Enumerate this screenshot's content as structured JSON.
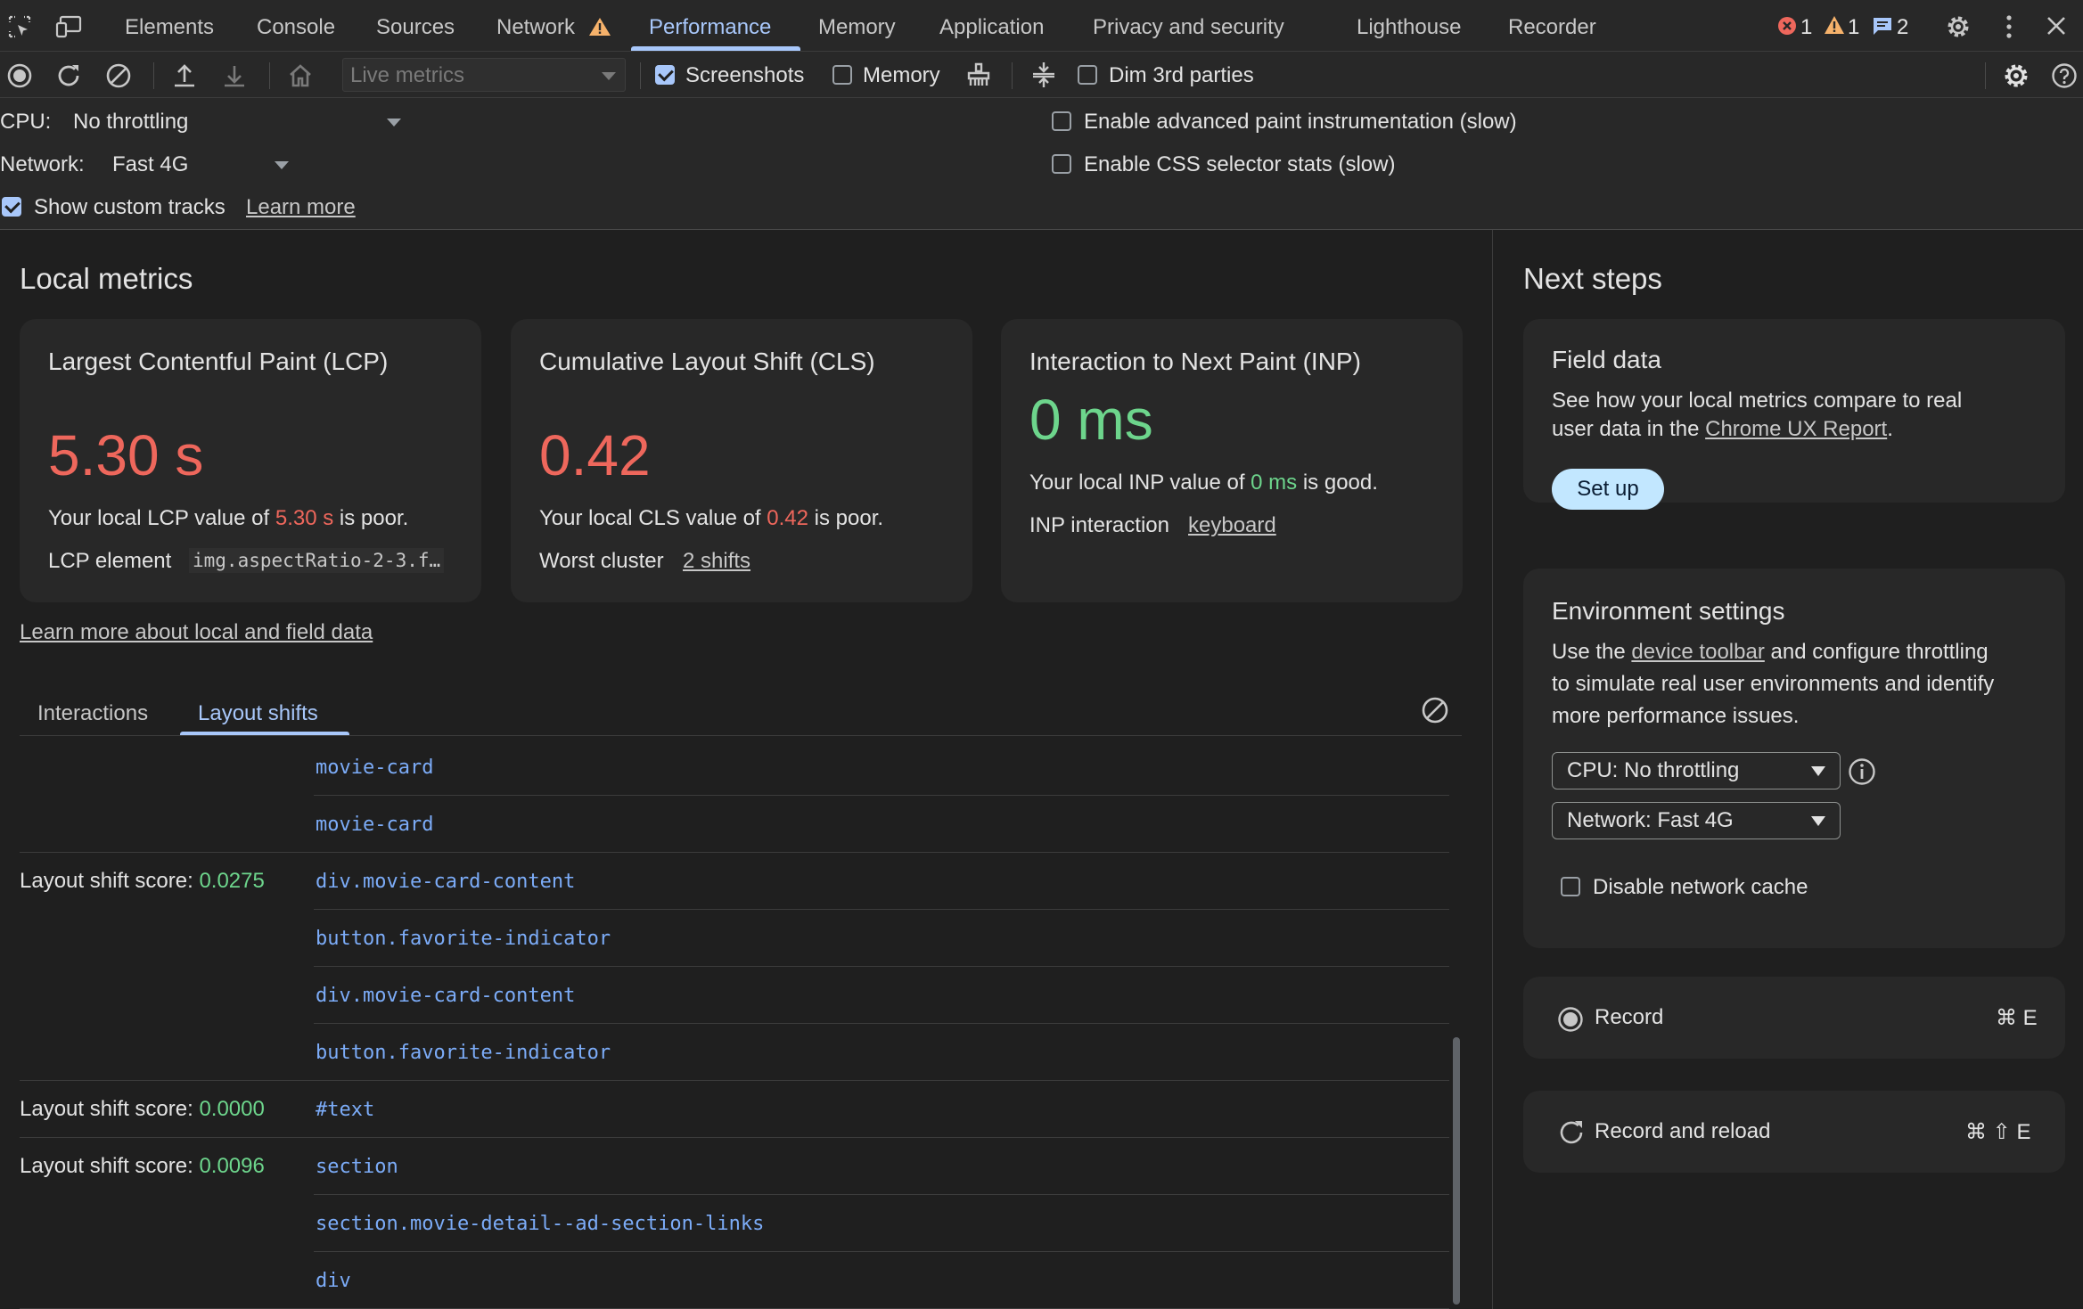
{
  "tabbar": {
    "tabs": [
      "Elements",
      "Console",
      "Sources",
      "Network",
      "Performance",
      "Memory",
      "Application",
      "Privacy and security",
      "Lighthouse",
      "Recorder"
    ],
    "active_tab": "Performance",
    "errors": "1",
    "warnings": "1",
    "messages": "2"
  },
  "toolbar": {
    "metrics_select": "Live metrics",
    "screenshots_label": "Screenshots",
    "screenshots_checked": true,
    "memory_label": "Memory",
    "memory_checked": false,
    "dim_label": "Dim 3rd parties",
    "dim_checked": false
  },
  "settings": {
    "cpu_label": "CPU:",
    "cpu_value": "No throttling",
    "network_label": "Network:",
    "network_value": "Fast 4G",
    "custom_tracks_label": "Show custom tracks",
    "custom_tracks_checked": true,
    "learn_more": "Learn more",
    "paint_label": "Enable advanced paint instrumentation (slow)",
    "css_label": "Enable CSS selector stats (slow)"
  },
  "local_metrics": {
    "heading": "Local metrics",
    "lcp": {
      "title": "Largest Contentful Paint (LCP)",
      "value": "5.30 s",
      "desc_prefix": "Your local LCP value of ",
      "desc_value": "5.30 s",
      "desc_suffix": " is poor.",
      "element_label": "LCP element",
      "element_value": "img.aspectRatio-2-3.f…"
    },
    "cls": {
      "title": "Cumulative Layout Shift (CLS)",
      "value": "0.42",
      "desc_prefix": "Your local CLS value of ",
      "desc_value": "0.42",
      "desc_suffix": " is poor.",
      "cluster_label": "Worst cluster",
      "cluster_value": "2 shifts"
    },
    "inp": {
      "title": "Interaction to Next Paint (INP)",
      "value": "0 ms",
      "desc_prefix": "Your local INP value of ",
      "desc_value": "0 ms",
      "desc_suffix": " is good.",
      "interaction_label": "INP interaction",
      "interaction_value": "keyboard"
    },
    "learn_more": "Learn more about local and field data"
  },
  "tabs": {
    "interactions": "Interactions",
    "layout_shifts": "Layout shifts"
  },
  "layout_shifts": {
    "score_label": "Layout shift score: ",
    "rows": [
      {
        "score": "",
        "node": "movie-card"
      },
      {
        "score": "",
        "node": "movie-card"
      },
      {
        "score": "0.0275",
        "node": "div.movie-card-content"
      },
      {
        "score": "",
        "node": "button.favorite-indicator"
      },
      {
        "score": "",
        "node": "div.movie-card-content"
      },
      {
        "score": "",
        "node": "button.favorite-indicator"
      },
      {
        "score": "0.0000",
        "node": "#text"
      },
      {
        "score": "0.0096",
        "node": "section"
      },
      {
        "score": "",
        "node": "section.movie-detail--ad-section-links"
      },
      {
        "score": "",
        "node": "div"
      }
    ]
  },
  "next_steps": {
    "heading": "Next steps",
    "field": {
      "title": "Field data",
      "desc_line1": "See how your local metrics compare to real",
      "desc_line2_prefix": "user data in the ",
      "desc_link": "Chrome UX Report",
      "desc_line2_suffix": ".",
      "button": "Set up"
    },
    "env": {
      "title": "Environment settings",
      "desc_line1_prefix": "Use the ",
      "desc_link": "device toolbar",
      "desc_line1_suffix": " and configure throttling",
      "desc_line2": "to simulate real user environments and identify",
      "desc_line3": "more performance issues.",
      "cpu_select": "CPU: No throttling",
      "network_select": "Network: Fast 4G",
      "cache_label": "Disable network cache"
    },
    "record": {
      "label": "Record",
      "shortcut": "⌘ E"
    },
    "record_reload": {
      "label": "Record and reload",
      "shortcut": "⌘ ⇧ E"
    }
  },
  "colors": {
    "poor": "#ee675c",
    "good": "#6dd58c",
    "accent": "#a8c7fa"
  }
}
